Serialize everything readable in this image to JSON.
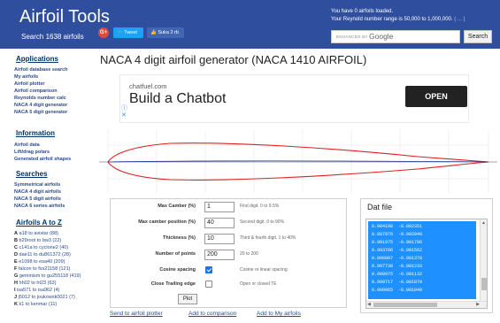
{
  "header": {
    "logo": "Airfoil Tools",
    "subtitle": "Search 1638 airfoils",
    "social": {
      "gplus": "G+",
      "tweet": "Tweet",
      "like": "Suka 2 rb"
    },
    "airfoils_loaded": "You have 0 airfoils loaded.",
    "reynolds_text": "Your Reynold number range is 50,000 to 1,000,000.",
    "reynolds_link": "( ... )",
    "search": {
      "enhanced_by": "ENHANCED BY",
      "google": "Google",
      "button": "Search"
    }
  },
  "sidebar": {
    "applications_title": "Applications",
    "applications": [
      "Airfoil database search",
      "My airfoils",
      "Airfoil plotter",
      "Airfoil comparison",
      "Reynolds number calc",
      "NACA 4 digit generator",
      "NACA 5 digit generator"
    ],
    "information_title": "Information",
    "information": [
      "Airfoil data",
      "Lift/drag polars",
      "Generated airfoil shapes"
    ],
    "searches_title": "Searches",
    "searches": [
      "Symmetrical airfoils",
      "NACA 4 digit airfoils",
      "NACA 5 digit airfoils",
      "NACA 6 series airfoils"
    ],
    "atoz_title": "Airfoils A to Z",
    "atoz": [
      {
        "letter": "A",
        "text": "a18 to avistar (88)"
      },
      {
        "letter": "B",
        "text": "b29root to bw3 (22)"
      },
      {
        "letter": "C",
        "text": "c141a to cyclone2 (40)"
      },
      {
        "letter": "D",
        "text": "dae11 to du861372 (28)"
      },
      {
        "letter": "E",
        "text": "e1098 to esa40 (209)"
      },
      {
        "letter": "F",
        "text": "falcon to fxs21158 (121)"
      },
      {
        "letter": "G",
        "text": "geminism to gu255118 (419)"
      },
      {
        "letter": "H",
        "text": "hh02 to ht23 (63)"
      },
      {
        "letter": "I",
        "text": "isa571 to isa962 (4)"
      },
      {
        "letter": "J",
        "text": "j5012 to joukowsk0021 (7)"
      },
      {
        "letter": "K",
        "text": "k1 to kenmar (11)"
      }
    ]
  },
  "main": {
    "title": "NACA 4 digit airfoil generator (NACA 1410 AIRFOIL)",
    "ad": {
      "domain": "chatfuel.com",
      "headline": "Build a Chatbot",
      "info": "ⓘ",
      "close": "✕",
      "cta": "OPEN"
    },
    "form": {
      "rows": [
        {
          "label": "Max Camber (%)",
          "value": "1",
          "help": "First digit. 0 to 9.5%"
        },
        {
          "label": "Max camber position (%)",
          "value": "40",
          "help": "Second digit. 0 to 90%"
        },
        {
          "label": "Thickness (%)",
          "value": "10",
          "help": "Third & fourth digit. 1 to 40%"
        },
        {
          "label": "Number of points",
          "value": "200",
          "help": "20 to 200"
        }
      ],
      "cosine_label": "Cosine spacing",
      "cosine_help": "Cosine or linear spacing",
      "cosine_checked": true,
      "trailing_label": "Close Trailing edge",
      "trailing_help": "Open or closed TE",
      "trailing_checked": false,
      "plot_button": "Plot"
    },
    "links": [
      "Send to airfoil plotter",
      "Add to comparison",
      "Add to My airfoils"
    ],
    "dat": {
      "title": "Dat file",
      "lines": [
        "0.984198  -0.002351",
        "0.987876  -0.002049",
        "0.991075  -0.001786",
        "0.993786  -0.001562",
        "0.996007  -0.001378",
        "0.997738  -0.001233",
        "0.998975  -0.001132",
        "0.999717  -0.001070",
        "0.999965  -0.001049"
      ]
    }
  },
  "colors": {
    "header_bg": "#2f4e9e",
    "link": "#2a4b8d",
    "airfoil_line": "#e02020",
    "camber_line": "#1e3a8a",
    "selection": "#1e90ff"
  }
}
